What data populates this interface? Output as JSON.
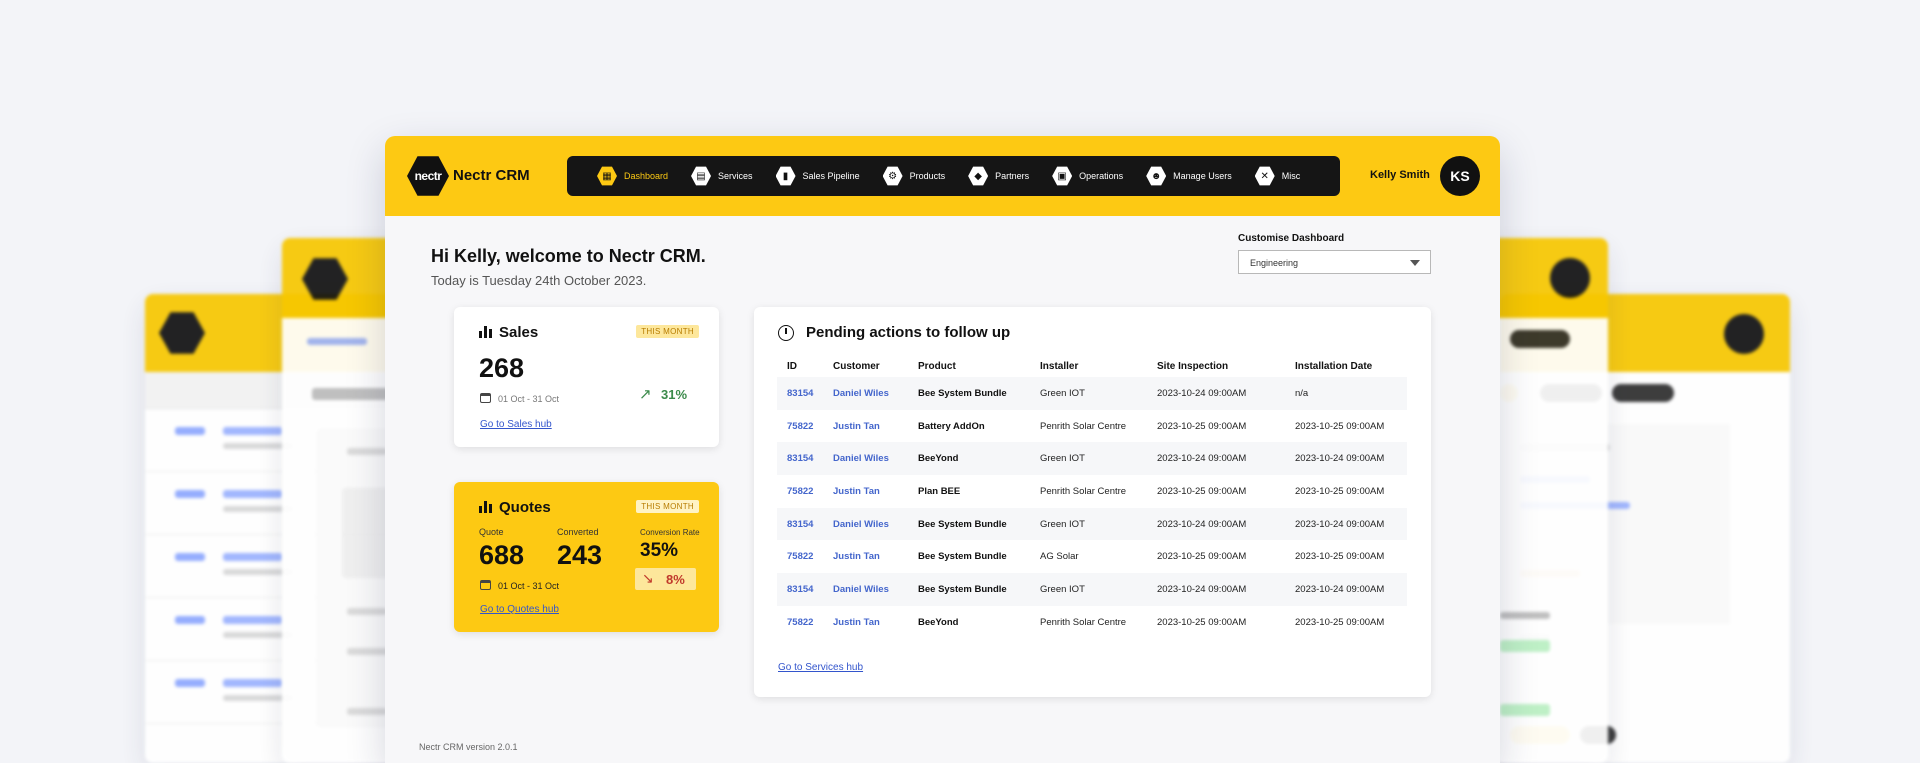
{
  "app": {
    "logo_text": "nectr",
    "name": "Nectr CRM"
  },
  "nav": {
    "items": [
      {
        "label": "Dashboard",
        "icon": "grid-icon",
        "glyph": "▦",
        "active": true
      },
      {
        "label": "Services",
        "icon": "solar-panel-icon",
        "glyph": "▤",
        "active": false
      },
      {
        "label": "Sales Pipeline",
        "icon": "bar-chart-icon",
        "glyph": "▮",
        "active": false
      },
      {
        "label": "Products",
        "icon": "gear-icon",
        "glyph": "⚙",
        "active": false
      },
      {
        "label": "Partners",
        "icon": "handshake-icon",
        "glyph": "◆",
        "active": false
      },
      {
        "label": "Operations",
        "icon": "clipboard-icon",
        "glyph": "▣",
        "active": false
      },
      {
        "label": "Manage Users",
        "icon": "users-icon",
        "glyph": "☻",
        "active": false
      },
      {
        "label": "Misc",
        "icon": "tools-icon",
        "glyph": "✕",
        "active": false
      }
    ]
  },
  "user": {
    "name": "Kelly Smith",
    "initials": "KS"
  },
  "header": {
    "welcome": "Hi Kelly, welcome to Nectr CRM.",
    "today": "Today is Tuesday 24th October 2023."
  },
  "customise": {
    "label": "Customise Dashboard",
    "selected": "Engineering"
  },
  "sales": {
    "title": "Sales",
    "badge": "THIS MONTH",
    "value": "268",
    "range": "01 Oct - 31 Oct",
    "trend": "31%",
    "link": "Go to Sales hub"
  },
  "quotes": {
    "title": "Quotes",
    "badge": "THIS MONTH",
    "quote_label": "Quote",
    "quote_value": "688",
    "converted_label": "Converted",
    "converted_value": "243",
    "rate_label": "Conversion Rate",
    "rate_value": "35%",
    "trend": "8%",
    "range": "01 Oct - 31 Oct",
    "link": "Go to Quotes hub"
  },
  "pending": {
    "title": "Pending actions to follow up",
    "columns": [
      "ID",
      "Customer",
      "Product",
      "Installer",
      "Site Inspection",
      "Installation Date"
    ],
    "rows": [
      [
        "83154",
        "Daniel Wiles",
        "Bee System Bundle",
        "Green IOT",
        "2023-10-24 09:00AM",
        "n/a"
      ],
      [
        "75822",
        "Justin Tan",
        "Battery AddOn",
        "Penrith Solar Centre",
        "2023-10-25 09:00AM",
        "2023-10-25 09:00AM"
      ],
      [
        "83154",
        "Daniel Wiles",
        "BeeYond",
        "Green IOT",
        "2023-10-24 09:00AM",
        "2023-10-24 09:00AM"
      ],
      [
        "75822",
        "Justin Tan",
        "Plan BEE",
        "Penrith Solar Centre",
        "2023-10-25 09:00AM",
        "2023-10-25 09:00AM"
      ],
      [
        "83154",
        "Daniel Wiles",
        "Bee System Bundle",
        "Green IOT",
        "2023-10-24 09:00AM",
        "2023-10-24 09:00AM"
      ],
      [
        "75822",
        "Justin Tan",
        "Bee System Bundle",
        "AG Solar",
        "2023-10-25 09:00AM",
        "2023-10-25 09:00AM"
      ],
      [
        "83154",
        "Daniel Wiles",
        "Bee System Bundle",
        "Green IOT",
        "2023-10-24 09:00AM",
        "2023-10-24 09:00AM"
      ],
      [
        "75822",
        "Justin Tan",
        "BeeYond",
        "Penrith Solar Centre",
        "2023-10-25 09:00AM",
        "2023-10-25 09:00AM"
      ]
    ],
    "link": "Go to Services hub"
  },
  "footer": {
    "version": "Nectr CRM version 2.0.1"
  },
  "colors": {
    "brand_yellow": "#fdc913",
    "nav_dark": "#151515",
    "link_blue": "#3355cc",
    "trend_green": "#3a8a4a",
    "trend_red": "#c0392b"
  }
}
